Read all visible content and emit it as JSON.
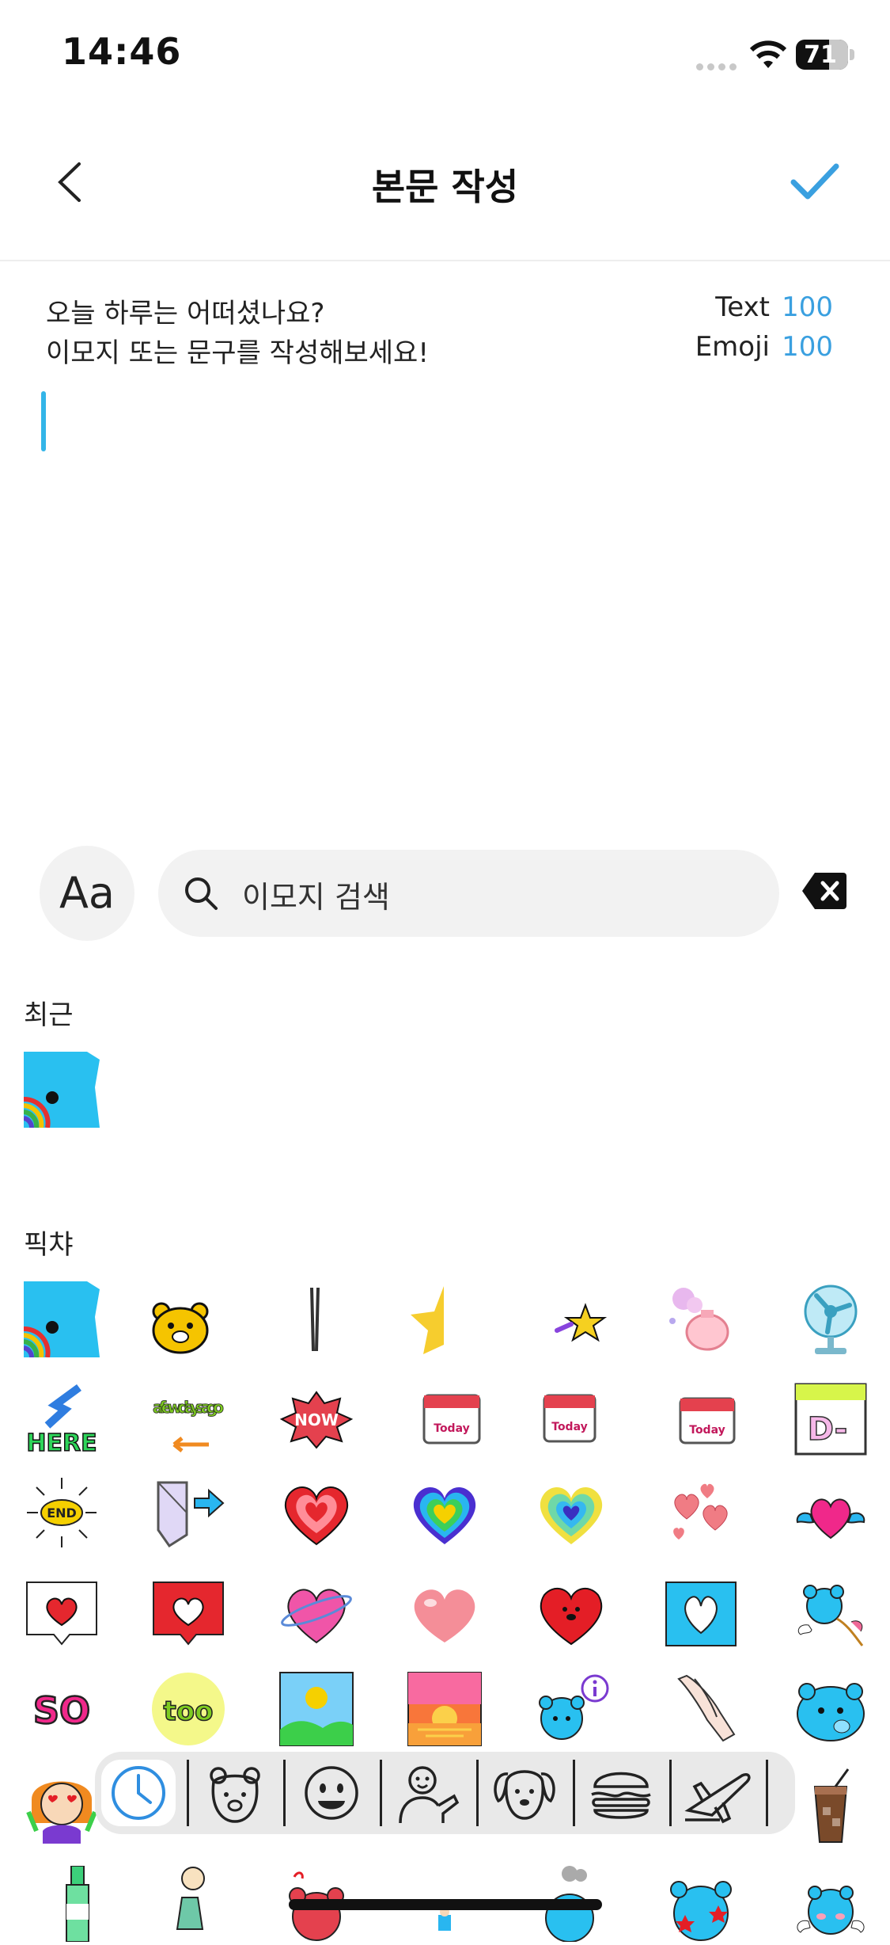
{
  "status_bar": {
    "time": "14:46",
    "battery": "71"
  },
  "header": {
    "title": "본문 작성"
  },
  "prompt": {
    "line1": "오늘 하루는 어떠셨나요?",
    "line2": "이모지 또는 문구를 작성해보세요!",
    "text_label": "Text",
    "text_count": "100",
    "emoji_label": "Emoji",
    "emoji_count": "100"
  },
  "toolbar": {
    "font_button": "Aa",
    "search_placeholder": "이모지 검색"
  },
  "sections": {
    "recent": "최근",
    "picha": "픽챠"
  },
  "stickers": {
    "here": "HERE",
    "a_few_days_ago": "a few days ago",
    "now": "NOW",
    "today": "Today",
    "d_minus": "D-",
    "end": "END",
    "so": "SO",
    "too": "too"
  },
  "tabs": [
    "recent-icon",
    "bear-icon",
    "smiley-icon",
    "person-icon",
    "dog-icon",
    "burger-icon",
    "airplane-icon"
  ],
  "colors": {
    "accent": "#3aa0e0",
    "cursor": "#33b5e8",
    "bear_blue": "#29c0f0"
  }
}
